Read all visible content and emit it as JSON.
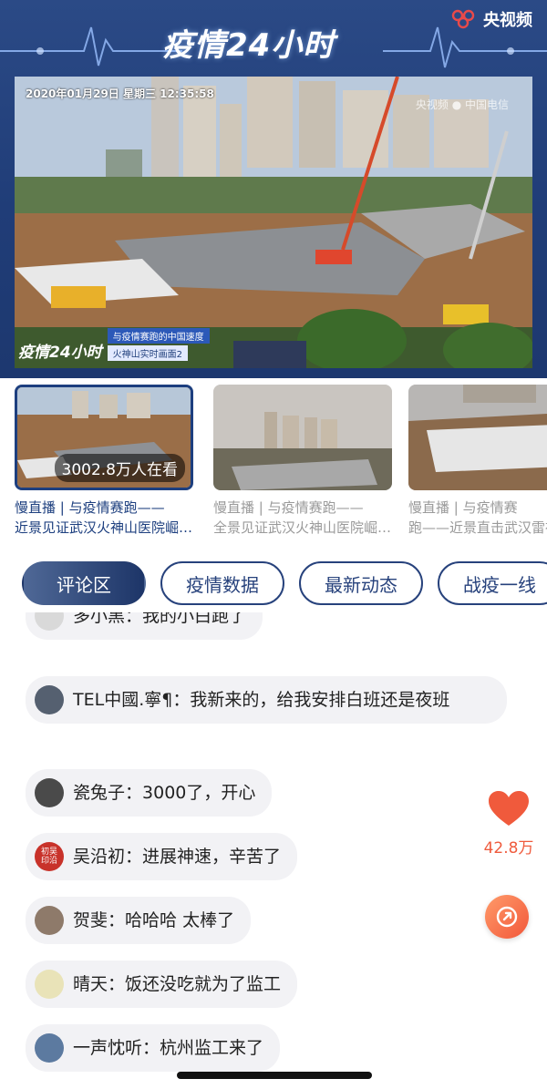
{
  "header": {
    "show_title": "疫情24小时",
    "brand": "央视频",
    "brand_icon": "cctv-logo-icon"
  },
  "live_video": {
    "timestamp": "2020年01月29日  星期三  12:35:58",
    "watermark": "央视频 ● 中国电信",
    "badge_logo": "疫情24小时",
    "badge_title": "与疫情赛跑的中国速度",
    "badge_subtitle": "火神山实时画面2"
  },
  "thumbnails": [
    {
      "caption": "慢直播 | 与疫情赛跑——近景见证武汉火神山医院崛…",
      "viewers": "3002.8万人在看",
      "active": true
    },
    {
      "caption": "慢直播 | 与疫情赛跑——全景见证武汉火神山医院崛…",
      "active": false
    },
    {
      "caption": "慢直播 | 与疫情赛跑——近景直击武汉雷神山医…",
      "active": false
    }
  ],
  "tabs": [
    {
      "label": "评论区",
      "active": true
    },
    {
      "label": "疫情数据",
      "active": false
    },
    {
      "label": "最新动态",
      "active": false
    },
    {
      "label": "战疫一线",
      "active": false
    }
  ],
  "comments": [
    {
      "user": "多小黑",
      "text": "我的小白跑了"
    },
    {
      "user": "TEL中國.寧¶",
      "text": "我新来的，给我安排白班还是夜班"
    },
    {
      "user": "瓷兔子",
      "text": "3000了，开心"
    },
    {
      "user": "吴沿初",
      "text": "进展神速，辛苦了",
      "avatar_text": "初吴印沿"
    },
    {
      "user": "贺斐",
      "text": "哈哈哈 太棒了"
    },
    {
      "user": "晴天",
      "text": "饭还没吃就为了监工"
    },
    {
      "user": "一声忱听",
      "text": "杭州监工来了"
    }
  ],
  "likes": {
    "count": "42.8万"
  },
  "colors": {
    "header_blue": "#203d78",
    "accent_navy": "#1d3f7f",
    "like_red": "#ef5b3d",
    "bubble_grey": "#f2f2f5"
  }
}
